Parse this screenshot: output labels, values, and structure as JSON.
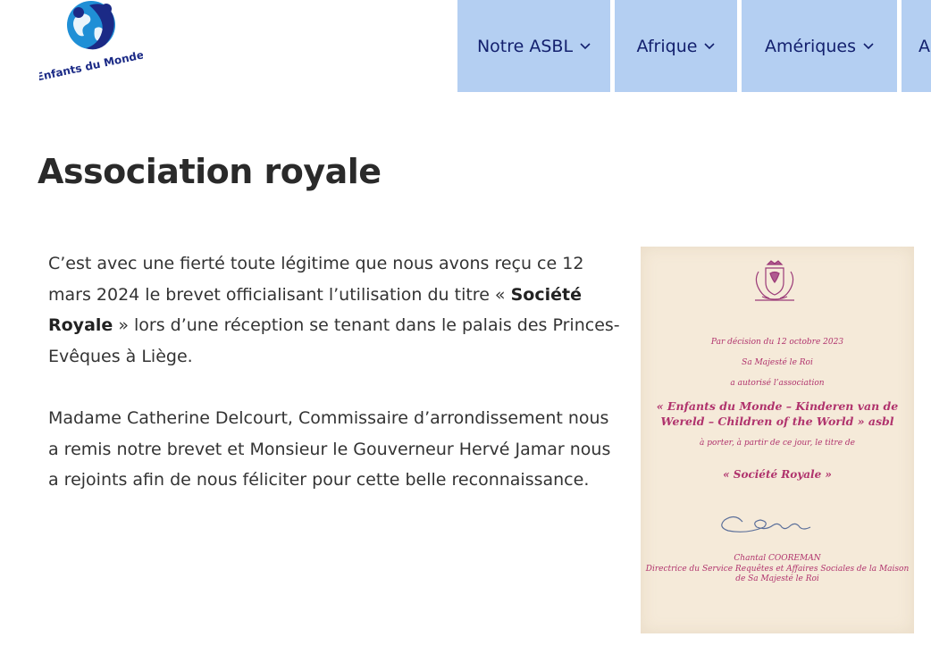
{
  "logo": {
    "text": "Enfants du Monde"
  },
  "nav": {
    "items": [
      {
        "label": "Notre ASBL"
      },
      {
        "label": "Afrique"
      },
      {
        "label": "Amériques"
      },
      {
        "label": "A"
      }
    ]
  },
  "page": {
    "title": "Association royale",
    "paragraph1": {
      "part1": "C’est avec une fierté toute légitime que nous avons reçu ce 12 mars 2024 le brevet officialisant l’utilisation du titre « ",
      "bold": "Société Royale",
      "part2": " »  lors d’une réception se tenant dans le palais des Princes-Evêques à Liège."
    },
    "paragraph2": "Madame Catherine Delcourt, Commissaire d’arrondissement nous a remis notre brevet et Monsieur le Gouverneur Hervé Jamar nous a rejoints afin de nous féliciter pour cette belle reconnaissance."
  },
  "certificate": {
    "line1": "Par décision du 12 octobre 2023",
    "line2": "Sa Majesté le Roi",
    "line3": "a autorisé l’association",
    "line4": "« Enfants du Monde – Kinderen van de Wereld – Children of the World » asbl",
    "line5": "à porter, à partir de ce jour, le titre de",
    "line6": "« Société Royale »",
    "signatory": "Chantal COOREMAN",
    "position": "Directrice du Service Requêtes et Affaires Sociales de la Maison de Sa Majesté le Roi"
  },
  "colors": {
    "nav_bg": "#b4cff2",
    "nav_text": "#13206e",
    "certificate_bg": "#f5ead9",
    "certificate_text": "#b0336d",
    "logo_blue": "#1f8fd6",
    "logo_navy": "#1b2a86"
  }
}
